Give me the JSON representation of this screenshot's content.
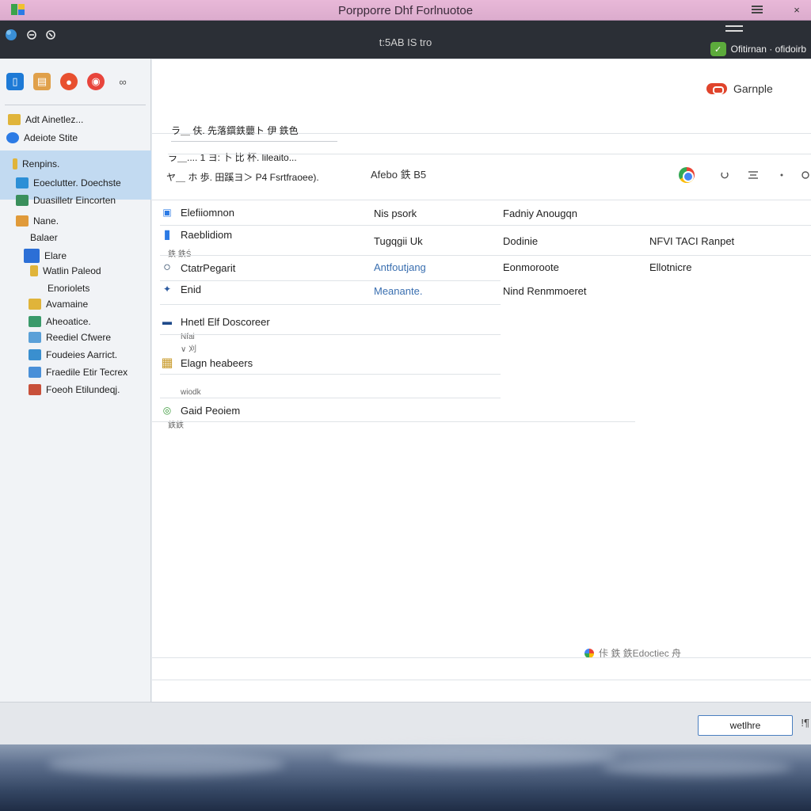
{
  "window": {
    "title": "Porpporre Dhf Forlnuotoe",
    "minimize_icon": "hamburger-icon",
    "close_label": "×"
  },
  "toolbar": {
    "center_label": "t:5AB IS tro",
    "user_name": "Ofitirnan · ofidoirb",
    "user_badge": "✓"
  },
  "sidebar": {
    "apps": [
      {
        "icon": "phone-app-icon",
        "color": "#1e7ad6",
        "glyph": "▯"
      },
      {
        "icon": "notes-app-icon",
        "color": "#e0a04a",
        "glyph": "▤"
      },
      {
        "icon": "chrome-app-icon",
        "color": "#e8502f",
        "glyph": "●"
      },
      {
        "icon": "chat-app-icon",
        "color": "#e8453c",
        "glyph": "◉"
      },
      {
        "icon": "link-app-icon",
        "color": "#555555",
        "glyph": "∞"
      }
    ],
    "items": [
      {
        "label": "Adt Ainetlez...",
        "icon_color": "#e0b43a"
      },
      {
        "label": "Adeiote Stite",
        "icon_color": "#2c7be5"
      },
      {
        "label": "Renpins.",
        "icon_color": "#e0b43a"
      },
      {
        "label": "Eoeclutter. Doechste",
        "icon_color": "#2c8fd6"
      },
      {
        "label": "Duasilletr Eincorten",
        "icon_color": "#3a8f5c"
      },
      {
        "label": "Nane.",
        "icon_color": "#e09a3a"
      },
      {
        "label": "Balaer",
        "icon_color": ""
      },
      {
        "label": "Elare",
        "icon_color": "#2c6fd6"
      },
      {
        "label": "Watlin Paleod",
        "icon_color": "#e0b43a"
      },
      {
        "label": "Enoriolets",
        "icon_color": ""
      },
      {
        "label": "Avamaine",
        "icon_color": "#e0b43a"
      },
      {
        "label": "Aheoatice.",
        "icon_color": "#3a9a6a"
      },
      {
        "label": "Reediel Cfwere",
        "icon_color": "#5aa0d8"
      },
      {
        "label": "Foudeies Aarrict.",
        "icon_color": "#3a8fcf"
      },
      {
        "label": "Fraedile Etir Tecrex",
        "icon_color": "#4a90d8"
      },
      {
        "label": "Foeoh Etilundeqj.",
        "icon_color": "#c8503a"
      }
    ]
  },
  "main": {
    "sample_label": "Garnple",
    "desc_lines": [
      "ラ＿ 伕. 先落鐉鉄蘡ト 伊 鉄色",
      "ラ＿.... 1 ヨ: 卜 比 杯. lileaito...",
      "ヤ＿ ホ 歩. 田蹊ヨ＞ P4 Fsrtfraoee)."
    ],
    "filter_label": "Afebo 鉄 B5",
    "rows": [
      {
        "name": "Elefiiomnon",
        "col2": "Nis psork",
        "col3": "Fadniy Anougqn",
        "col4": "",
        "col2_link": false,
        "sub": "",
        "icon_color": "#2c7be5",
        "glyph": "▣"
      },
      {
        "name": "Raeblidiom",
        "col2": "Tugqgii Uk",
        "col3": "Dodinie",
        "col4": "NFVI TACI Ranpet",
        "col2_link": false,
        "sub": "鉄 鉄Ś",
        "icon_color": "#2c7be5",
        "glyph": "▮"
      },
      {
        "name": "CtatrPegarit",
        "col2": "Antfoutjang",
        "col3": "Eonmoroote",
        "col4": "Ellotnicre",
        "col2_link": true,
        "sub": "",
        "icon_color": "#1e3a5a",
        "glyph": "○"
      },
      {
        "name": "Enid",
        "col2": "Meanante.",
        "col3": "Nind Renmmoeret",
        "col4": "",
        "col2_link": true,
        "sub": "",
        "icon_color": "#2c5aa0",
        "glyph": "✦"
      },
      {
        "name": "Hnetl Elf Doscoreer",
        "col2": "",
        "col3": "",
        "col4": "",
        "col2_link": false,
        "sub": "Nfai",
        "icon_color": "#1e4a8a",
        "glyph": "▬"
      },
      {
        "name": "Elagn heabeers",
        "col2": "",
        "col3": "",
        "col4": "",
        "col2_link": false,
        "sub": "wiodk",
        "icon_color": "#c89a2a",
        "glyph": "▦"
      },
      {
        "name": "Gaid Peoiem",
        "col2": "",
        "col3": "",
        "col4": "",
        "col2_link": false,
        "sub": "鉄鉄",
        "icon_color": "#3a9a3a",
        "glyph": "◎"
      }
    ],
    "extra_sub": "∨ 刈",
    "footer_note": "佧 鉄 鉄Edoctiec 舟"
  },
  "bottombar": {
    "ok_label": "wetlhre",
    "extra_glyph": "!¶"
  }
}
